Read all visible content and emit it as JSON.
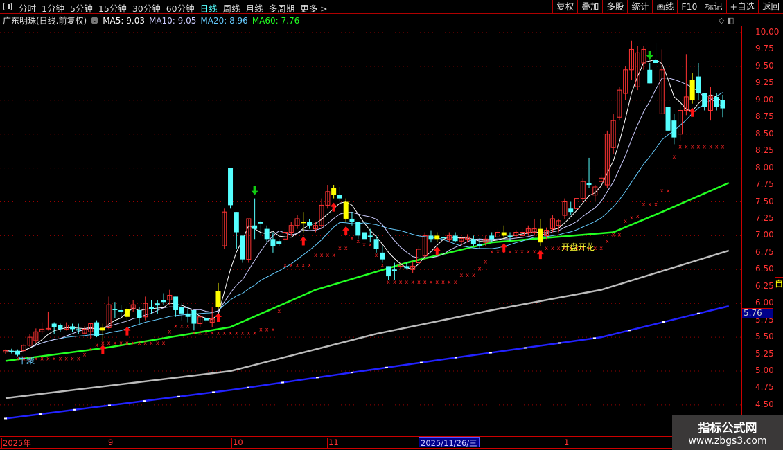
{
  "toolbar": {
    "periods": [
      "分时",
      "1分钟",
      "5分钟",
      "15分钟",
      "30分钟",
      "60分钟",
      "日线",
      "周线",
      "月线",
      "多周期",
      "更多 >"
    ],
    "active": "日线",
    "right_buttons": [
      "复权",
      "叠加",
      "多股",
      "统计",
      "画线",
      "F10",
      "标记",
      "+自选",
      "返回"
    ]
  },
  "info": {
    "stock": "广东明珠(日线.前复权)",
    "ma5": "MA5: 9.03",
    "ma10": "MA10: 9.05",
    "ma20": "MA20: 8.96",
    "ma60": "MA60: 7.76"
  },
  "colors": {
    "up": "#ff3333",
    "down": "#55ffff",
    "ma5": "#ffffff",
    "ma10": "#ccccff",
    "ma20": "#66ccff",
    "ma60": "#22ff22",
    "signal": "#ffff00"
  },
  "axis": {
    "labels": [
      "10.00",
      "9.75",
      "9.50",
      "9.25",
      "9.00",
      "8.75",
      "8.50",
      "8.25",
      "8.00",
      "7.75",
      "7.50",
      "7.25",
      "7.00",
      "6.75",
      "6.50",
      "6.25",
      "6.00",
      "5.75",
      "5.50",
      "5.25",
      "5.00",
      "4.75",
      "4.50"
    ],
    "last_price": "5.76"
  },
  "dates": {
    "labels": [
      "2025年",
      "9",
      "10",
      "11",
      "1"
    ],
    "selected": "2025/11/26/三"
  },
  "annotations": {
    "left": "牛聚",
    "right": "开盘开花"
  },
  "right_panel": {
    "yellow": "自"
  },
  "watermark": {
    "title": "指标公式网",
    "url": "www.zbgs3.com"
  },
  "chart_data": {
    "type": "candlestick",
    "ylim": [
      4.4,
      10.1
    ],
    "ohlc": [
      [
        5.28,
        5.32,
        5.25,
        5.3
      ],
      [
        5.3,
        5.33,
        5.26,
        5.29
      ],
      [
        5.3,
        5.32,
        5.22,
        5.24
      ],
      [
        5.3,
        5.4,
        5.28,
        5.38
      ],
      [
        5.38,
        5.55,
        5.36,
        5.5
      ],
      [
        5.45,
        5.63,
        5.42,
        5.58
      ],
      [
        5.58,
        5.72,
        5.55,
        5.62
      ],
      [
        5.62,
        5.88,
        5.6,
        5.63
      ],
      [
        5.7,
        5.72,
        5.55,
        5.65
      ],
      [
        5.68,
        5.7,
        5.58,
        5.62
      ],
      [
        5.62,
        5.72,
        5.6,
        5.68
      ],
      [
        5.66,
        5.7,
        5.58,
        5.62
      ],
      [
        5.62,
        5.7,
        5.55,
        5.6
      ],
      [
        5.56,
        5.66,
        5.54,
        5.62
      ],
      [
        5.58,
        5.7,
        5.48,
        5.7
      ],
      [
        5.72,
        5.75,
        5.5,
        5.52
      ],
      [
        5.6,
        5.7,
        5.45,
        5.64
      ],
      [
        5.64,
        6.1,
        5.62,
        5.98
      ],
      [
        5.92,
        6.02,
        5.78,
        5.9
      ],
      [
        5.9,
        5.98,
        5.8,
        5.88
      ],
      [
        5.8,
        5.94,
        5.72,
        5.92
      ],
      [
        5.92,
        6.05,
        5.88,
        5.98
      ],
      [
        5.9,
        5.94,
        5.7,
        5.78
      ],
      [
        5.8,
        6.1,
        5.75,
        6.0
      ],
      [
        5.95,
        6.05,
        5.85,
        5.92
      ],
      [
        6.0,
        6.05,
        5.85,
        5.97
      ],
      [
        6.05,
        6.15,
        5.98,
        6.02
      ],
      [
        6.05,
        6.2,
        5.98,
        6.12
      ],
      [
        6.1,
        6.1,
        5.8,
        5.9
      ],
      [
        5.95,
        6.0,
        5.75,
        5.85
      ],
      [
        5.85,
        5.95,
        5.72,
        5.8
      ],
      [
        5.9,
        5.9,
        5.6,
        5.7
      ],
      [
        5.7,
        5.85,
        5.65,
        5.8
      ],
      [
        5.78,
        5.82,
        5.72,
        5.75
      ],
      [
        5.72,
        5.95,
        5.65,
        5.77
      ],
      [
        5.95,
        6.3,
        5.92,
        6.18
      ],
      [
        6.85,
        7.4,
        6.8,
        7.35
      ],
      [
        8.0,
        8.0,
        7.4,
        7.45
      ],
      [
        7.35,
        7.35,
        6.8,
        7.05
      ],
      [
        7.0,
        7.0,
        6.6,
        6.65
      ],
      [
        6.65,
        7.25,
        6.6,
        7.25
      ],
      [
        7.15,
        7.55,
        6.95,
        7.1
      ],
      [
        7.2,
        7.22,
        7.0,
        7.18
      ],
      [
        7.1,
        7.15,
        6.9,
        6.95
      ],
      [
        6.95,
        7.05,
        6.75,
        6.85
      ],
      [
        6.92,
        6.95,
        6.85,
        6.88
      ],
      [
        6.95,
        7.1,
        6.85,
        7.05
      ],
      [
        7.05,
        7.2,
        7.0,
        7.15
      ],
      [
        7.15,
        7.3,
        7.1,
        7.25
      ],
      [
        7.2,
        7.35,
        7.05,
        7.2
      ],
      [
        7.2,
        7.25,
        7.1,
        7.15
      ],
      [
        7.1,
        7.2,
        7.05,
        7.15
      ],
      [
        7.15,
        7.55,
        7.1,
        7.45
      ],
      [
        7.45,
        7.75,
        7.4,
        7.65
      ],
      [
        7.7,
        7.75,
        7.55,
        7.6
      ],
      [
        7.6,
        7.72,
        7.5,
        7.55
      ],
      [
        7.5,
        7.55,
        7.2,
        7.25
      ],
      [
        7.25,
        7.35,
        7.15,
        7.2
      ],
      [
        7.2,
        7.2,
        6.95,
        7.0
      ],
      [
        7.05,
        7.15,
        6.9,
        6.95
      ],
      [
        7.0,
        7.1,
        6.9,
        6.98
      ],
      [
        6.95,
        7.0,
        6.75,
        6.8
      ],
      [
        6.75,
        6.85,
        6.6,
        6.65
      ],
      [
        6.55,
        6.55,
        6.35,
        6.4
      ],
      [
        6.5,
        6.6,
        6.35,
        6.48
      ],
      [
        6.55,
        6.6,
        6.5,
        6.58
      ],
      [
        6.55,
        6.6,
        6.5,
        6.52
      ],
      [
        6.5,
        6.62,
        6.45,
        6.55
      ],
      [
        6.6,
        6.85,
        6.55,
        6.8
      ],
      [
        6.7,
        7.05,
        6.65,
        7.0
      ],
      [
        7.0,
        7.08,
        6.9,
        6.95
      ],
      [
        6.95,
        7.05,
        6.9,
        7.0
      ],
      [
        6.98,
        7.05,
        6.92,
        6.96
      ],
      [
        6.95,
        7.05,
        6.9,
        7.0
      ],
      [
        7.0,
        7.05,
        6.9,
        6.92
      ],
      [
        6.92,
        6.98,
        6.85,
        6.96
      ],
      [
        6.95,
        7.02,
        6.9,
        6.98
      ],
      [
        6.95,
        7.0,
        6.85,
        6.88
      ],
      [
        6.88,
        6.96,
        6.8,
        6.85
      ],
      [
        6.9,
        7.0,
        6.85,
        6.95
      ],
      [
        7.0,
        7.05,
        6.9,
        6.95
      ],
      [
        6.98,
        7.1,
        6.95,
        7.05
      ],
      [
        7.05,
        7.15,
        6.95,
        7.0
      ],
      [
        7.0,
        7.05,
        6.92,
        6.98
      ],
      [
        7.0,
        7.08,
        6.95,
        7.05
      ],
      [
        7.0,
        7.1,
        6.95,
        7.05
      ],
      [
        7.05,
        7.15,
        7.0,
        7.1
      ],
      [
        7.05,
        7.25,
        7.0,
        7.1
      ],
      [
        7.1,
        7.25,
        6.85,
        6.9
      ],
      [
        7.0,
        7.12,
        6.95,
        7.08
      ],
      [
        7.1,
        7.3,
        7.05,
        7.25
      ],
      [
        7.15,
        7.25,
        7.05,
        7.22
      ],
      [
        7.3,
        7.55,
        7.25,
        7.5
      ],
      [
        7.4,
        7.5,
        7.3,
        7.35
      ],
      [
        7.4,
        7.6,
        7.32,
        7.55
      ],
      [
        7.55,
        7.85,
        7.5,
        7.8
      ],
      [
        7.78,
        8.15,
        7.7,
        7.75
      ],
      [
        7.6,
        7.75,
        7.5,
        7.72
      ],
      [
        7.8,
        7.9,
        7.75,
        7.85
      ],
      [
        7.75,
        8.55,
        7.7,
        8.5
      ],
      [
        8.3,
        8.8,
        8.2,
        8.7
      ],
      [
        8.75,
        9.2,
        8.7,
        9.15
      ],
      [
        9.1,
        9.5,
        9.0,
        9.45
      ],
      [
        9.45,
        9.88,
        9.3,
        9.75
      ],
      [
        9.2,
        9.8,
        9.15,
        9.7
      ],
      [
        9.55,
        9.8,
        9.45,
        9.75
      ],
      [
        9.45,
        9.55,
        9.25,
        9.25
      ],
      [
        9.6,
        9.85,
        9.45,
        9.55
      ],
      [
        8.8,
        9.75,
        8.8,
        9.45
      ],
      [
        8.9,
        8.9,
        8.55,
        8.55
      ],
      [
        8.7,
        8.8,
        8.35,
        8.45
      ],
      [
        8.5,
        8.95,
        8.4,
        8.85
      ],
      [
        8.85,
        9.68,
        8.78,
        9.05
      ],
      [
        9.0,
        9.4,
        8.95,
        9.3
      ],
      [
        9.35,
        9.55,
        9.0,
        9.1
      ],
      [
        9.1,
        9.1,
        8.85,
        8.9
      ],
      [
        8.85,
        9.2,
        8.7,
        9.05
      ],
      [
        9.05,
        9.1,
        8.85,
        8.9
      ],
      [
        9.0,
        9.08,
        8.75,
        8.88
      ]
    ],
    "signal_up": [
      16,
      20,
      35,
      49,
      54,
      56,
      71,
      82,
      88,
      113,
      119
    ],
    "signal_down": [
      41,
      106
    ],
    "ma60_line": [
      [
        0,
        5.15
      ],
      [
        17,
        5.35
      ],
      [
        37,
        5.65
      ],
      [
        51,
        6.2
      ],
      [
        66,
        6.6
      ],
      [
        80,
        6.9
      ],
      [
        100,
        7.05
      ],
      [
        108,
        7.35
      ],
      [
        119,
        7.78
      ]
    ],
    "gray_line": [
      [
        0,
        4.6
      ],
      [
        37,
        5.0
      ],
      [
        61,
        5.55
      ],
      [
        80,
        5.9
      ],
      [
        98,
        6.2
      ],
      [
        119,
        6.78
      ]
    ],
    "blue_line": [
      [
        0,
        4.3
      ],
      [
        37,
        4.72
      ],
      [
        71,
        5.16
      ],
      [
        98,
        5.5
      ],
      [
        119,
        5.96
      ]
    ]
  }
}
